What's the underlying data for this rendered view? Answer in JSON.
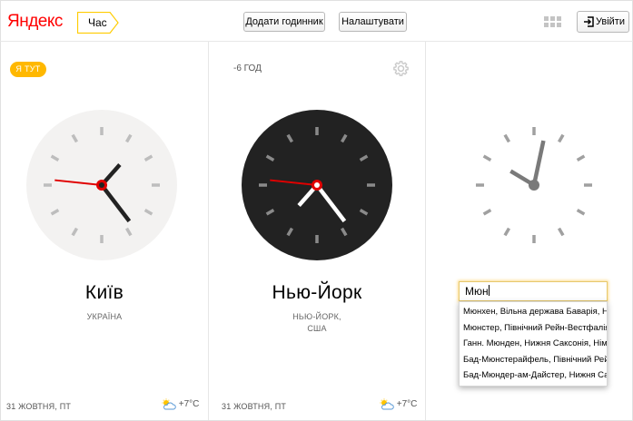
{
  "header": {
    "logo": "Яндекс",
    "service": "Час",
    "add_clock": "Додати годинник",
    "settings": "Налаштувати",
    "login": "Увійти"
  },
  "clocks": [
    {
      "badge": "Я ТУТ",
      "city": "Київ",
      "country": "УКРАЇНА",
      "date": "31 ЖОВТНЯ, ПТ",
      "temp": "+7°C",
      "theme": "light",
      "time": {
        "hour": 1,
        "minute": 23,
        "second": 46
      }
    },
    {
      "tz_offset": "-6 ГОД",
      "city": "Нью-Йорк",
      "country_line1": "НЬЮ-ЙОРК,",
      "country_line2": "США",
      "date": "31 ЖОВТНЯ, ПТ",
      "temp": "+7°C",
      "theme": "dark",
      "time": {
        "hour": 7,
        "minute": 23,
        "second": 46
      }
    },
    {
      "theme": "plain",
      "time": {
        "hour": 10,
        "minute": 2,
        "second": 0
      }
    }
  ],
  "search": {
    "value": "Мюн",
    "suggestions": [
      "Мюнхен, Вільна держава Баварія, Німеччина",
      "Мюнстер, Північний Рейн-Вестфалія, Німеччина",
      "Ганн. Мюнден, Нижня Саксонія, Німеччина",
      "Бад-Мюнстерайфель, Північний Рейн-Вестфалія",
      "Бад-Мюндер-ам-Дайстер, Нижня Саксонія"
    ]
  },
  "colors": {
    "accent": "#ffb800",
    "logo_red": "#ff0000",
    "second_hand": "#e00000",
    "dark_face": "#222222",
    "light_face": "#f3f2f1"
  }
}
